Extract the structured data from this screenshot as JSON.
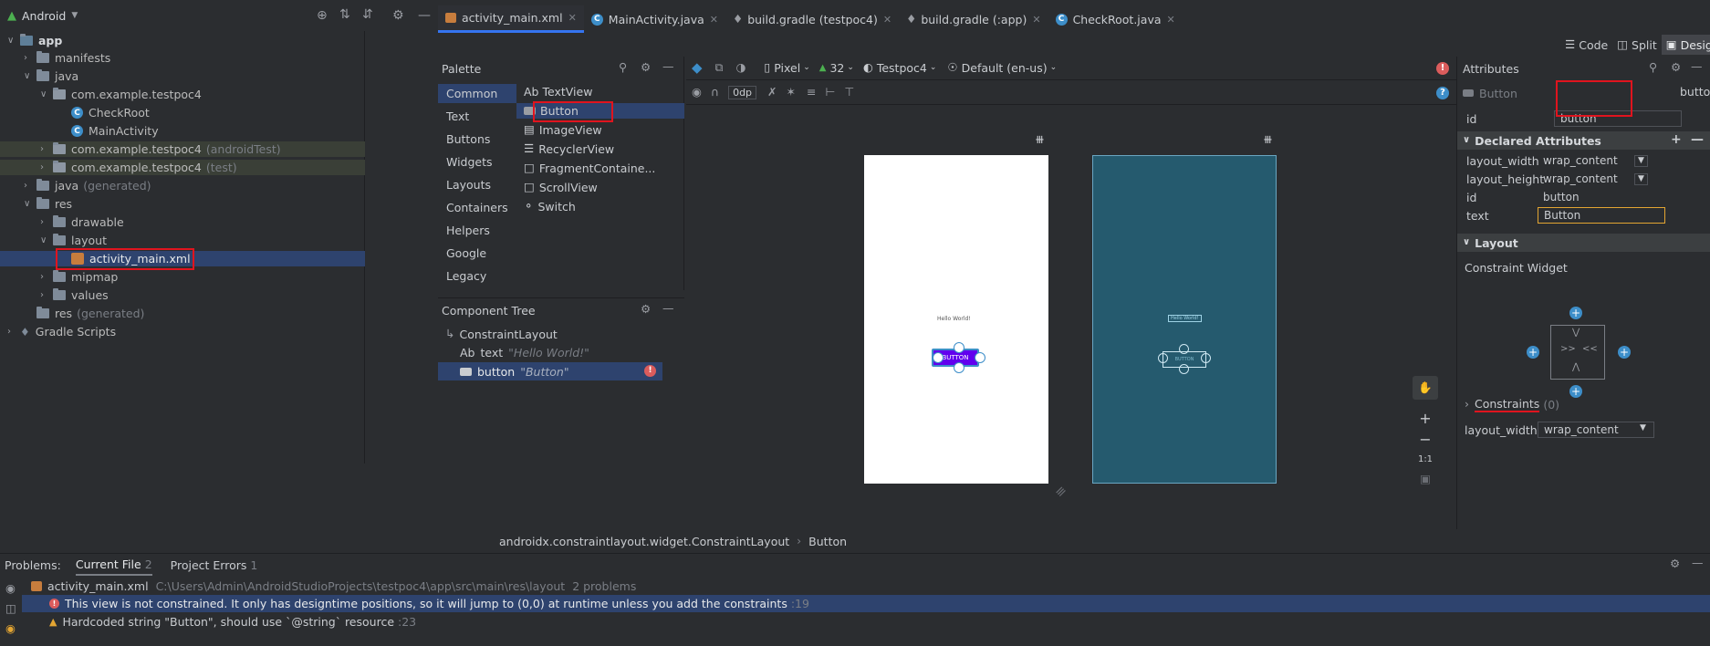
{
  "project": {
    "view_label": "Android",
    "tree": [
      {
        "label": "app",
        "muted": ""
      },
      {
        "label": "manifests",
        "muted": ""
      },
      {
        "label": "java",
        "muted": ""
      },
      {
        "label": "com.example.testpoc4",
        "muted": ""
      },
      {
        "label": "CheckRoot",
        "muted": ""
      },
      {
        "label": "MainActivity",
        "muted": ""
      },
      {
        "label": "com.example.testpoc4",
        "muted": "(androidTest)"
      },
      {
        "label": "com.example.testpoc4",
        "muted": "(test)"
      },
      {
        "label": "java",
        "muted": "(generated)"
      },
      {
        "label": "res",
        "muted": ""
      },
      {
        "label": "drawable",
        "muted": ""
      },
      {
        "label": "layout",
        "muted": ""
      },
      {
        "label": "activity_main.xml",
        "muted": ""
      },
      {
        "label": "mipmap",
        "muted": ""
      },
      {
        "label": "values",
        "muted": ""
      },
      {
        "label": "res",
        "muted": "(generated)"
      },
      {
        "label": "Gradle Scripts",
        "muted": ""
      }
    ]
  },
  "editor_tabs": [
    {
      "label": "activity_main.xml"
    },
    {
      "label": "MainActivity.java"
    },
    {
      "label": "build.gradle (testpoc4)"
    },
    {
      "label": "build.gradle (:app)"
    },
    {
      "label": "CheckRoot.java"
    }
  ],
  "view_modes": {
    "code": "Code",
    "split": "Split",
    "design": "Design"
  },
  "palette": {
    "title": "Palette",
    "categories": [
      "Common",
      "Text",
      "Buttons",
      "Widgets",
      "Layouts",
      "Containers",
      "Helpers",
      "Google",
      "Legacy"
    ],
    "items": [
      {
        "prefix": "Ab",
        "label": "TextView"
      },
      {
        "prefix": "",
        "label": "Button"
      },
      {
        "prefix": "",
        "label": "ImageView"
      },
      {
        "prefix": "",
        "label": "RecyclerView"
      },
      {
        "prefix": "",
        "label": "FragmentContaine..."
      },
      {
        "prefix": "",
        "label": "ScrollView"
      },
      {
        "prefix": "",
        "label": "Switch"
      }
    ]
  },
  "component_tree": {
    "title": "Component Tree",
    "root": "ConstraintLayout",
    "children": [
      {
        "prefix": "Ab",
        "name": "text",
        "value": "\"Hello World!\""
      },
      {
        "prefix": "",
        "name": "button",
        "value": "\"Button\""
      }
    ]
  },
  "design_toolbar": {
    "device": "Pixel",
    "api": "32",
    "theme": "Testpoc4",
    "locale": "Default (en-us)",
    "margin": "0dp"
  },
  "canvas": {
    "hello_text": "Hello World!",
    "button_text": "BUTTON",
    "zoom_fit": "1:1",
    "plus": "+",
    "minus": "−"
  },
  "breadcrumb": [
    "androidx.constraintlayout.widget.ConstraintLayout",
    "Button"
  ],
  "attributes": {
    "title": "Attributes",
    "widget_type": "Button",
    "widget_name": "button",
    "id_label": "id",
    "id_value": "button",
    "declared_title": "Declared Attributes",
    "declared": [
      {
        "name": "layout_width",
        "value": "wrap_content"
      },
      {
        "name": "layout_height",
        "value": "wrap_content"
      },
      {
        "name": "id",
        "value": "button"
      },
      {
        "name": "text",
        "value": "Button"
      }
    ],
    "layout_title": "Layout",
    "constraint_widget": "Constraint Widget",
    "constraints_label": "Constraints",
    "constraints_count": "(0)",
    "bottom_row": {
      "name": "layout_width",
      "value": "wrap_content"
    }
  },
  "problems": {
    "label": "Problems:",
    "tabs": [
      {
        "label": "Current File",
        "count": "2"
      },
      {
        "label": "Project Errors",
        "count": "1"
      }
    ],
    "file": "activity_main.xml",
    "path": "C:\\Users\\Admin\\AndroidStudioProjects\\testpoc4\\app\\src\\main\\res\\layout",
    "summary": "2 problems",
    "items": [
      {
        "text": "This view is not constrained. It only has designtime positions, so it will jump to (0,0) at runtime unless you add the constraints",
        "line": ":19"
      },
      {
        "text": "Hardcoded string \"Button\", should use `@string` resource",
        "line": ":23"
      }
    ]
  },
  "colors": {
    "accent_purple": "#6200ee",
    "blueprint": "#255a6e",
    "selection": "#2e436e",
    "highlight_red": "#e0141e"
  }
}
